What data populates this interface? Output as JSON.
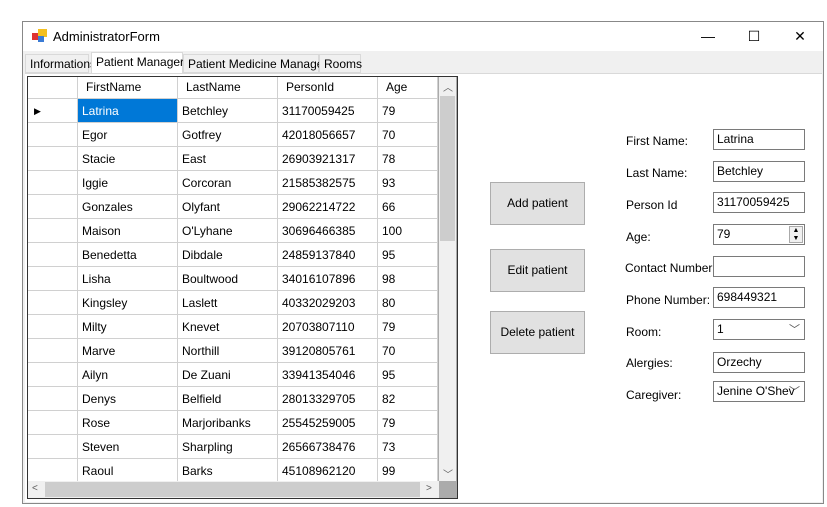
{
  "window": {
    "title": "AdministratorForm",
    "minimize": "—",
    "maximize": "☐",
    "close": "✕"
  },
  "tabs": [
    {
      "label": "Informations"
    },
    {
      "label": "Patient Manager"
    },
    {
      "label": "Patient Medicine Manager"
    },
    {
      "label": "Rooms"
    }
  ],
  "grid": {
    "columns": [
      "FirstName",
      "LastName",
      "PersonId",
      "Age"
    ],
    "rows": [
      [
        "Latrina",
        "Betchley",
        "31170059425",
        "79"
      ],
      [
        "Egor",
        "Gotfrey",
        "42018056657",
        "70"
      ],
      [
        "Stacie",
        "East",
        "26903921317",
        "78"
      ],
      [
        "Iggie",
        "Corcoran",
        "21585382575",
        "93"
      ],
      [
        "Gonzales",
        "Olyfant",
        "29062214722",
        "66"
      ],
      [
        "Maison",
        "O'Lyhane",
        "30696466385",
        "100"
      ],
      [
        "Benedetta",
        "Dibdale",
        "24859137840",
        "95"
      ],
      [
        "Lisha",
        "Boultwood",
        "34016107896",
        "98"
      ],
      [
        "Kingsley",
        "Laslett",
        "40332029203",
        "80"
      ],
      [
        "Milty",
        "Knevet",
        "20703807110",
        "79"
      ],
      [
        "Marve",
        "Northill",
        "39120805761",
        "70"
      ],
      [
        "Ailyn",
        "De Zuani",
        "33941354046",
        "95"
      ],
      [
        "Denys",
        "Belfield",
        "28013329705",
        "82"
      ],
      [
        "Rose",
        "Marjoribanks",
        "25545259005",
        "79"
      ],
      [
        "Steven",
        "Sharpling",
        "26566738476",
        "73"
      ],
      [
        "Raoul",
        "Barks",
        "45108962120",
        "99"
      ]
    ],
    "current_row_marker": "▶",
    "selected_color": "#0078d7"
  },
  "buttons": {
    "add": "Add patient",
    "edit": "Edit patient",
    "delete": "Delete patient"
  },
  "form": {
    "first_name": {
      "label": "First Name:",
      "value": "Latrina"
    },
    "last_name": {
      "label": "Last Name:",
      "value": "Betchley"
    },
    "person_id": {
      "label": "Person Id",
      "value": "31170059425"
    },
    "age": {
      "label": "Age:",
      "value": "79"
    },
    "contact": {
      "label": "Contact Number:",
      "value": ""
    },
    "phone": {
      "label": "Phone Number:",
      "value": "698449321"
    },
    "room": {
      "label": "Room:",
      "value": "1"
    },
    "alergies": {
      "label": "Alergies:",
      "value": "Orzechy"
    },
    "caregiver": {
      "label": "Caregiver:",
      "value": "Jenine O'Shev"
    }
  }
}
